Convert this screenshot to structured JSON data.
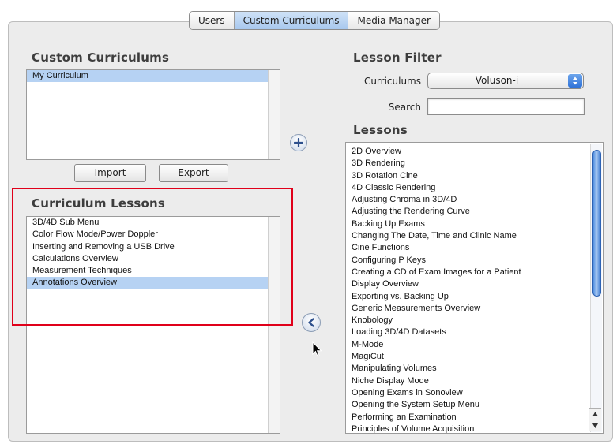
{
  "tabs": [
    {
      "label": "Users",
      "active": false
    },
    {
      "label": "Custom Curriculums",
      "active": true
    },
    {
      "label": "Media Manager",
      "active": false
    }
  ],
  "custom_curriculums": {
    "heading": "Custom Curriculums",
    "items": [
      {
        "label": "My Curriculum",
        "selected": true
      }
    ],
    "import_label": "Import",
    "export_label": "Export"
  },
  "curriculum_lessons": {
    "heading": "Curriculum Lessons",
    "items": [
      {
        "label": "3D/4D Sub Menu",
        "selected": false
      },
      {
        "label": "Color Flow Mode/Power Doppler",
        "selected": false
      },
      {
        "label": "Inserting and Removing a USB Drive",
        "selected": false
      },
      {
        "label": "Calculations Overview",
        "selected": false
      },
      {
        "label": "Measurement Techniques",
        "selected": false
      },
      {
        "label": "Annotations Overview",
        "selected": true
      }
    ]
  },
  "lesson_filter": {
    "heading": "Lesson Filter",
    "curriculums_label": "Curriculums",
    "curriculums_value": "Voluson-i",
    "search_label": "Search",
    "search_value": ""
  },
  "lessons": {
    "heading": "Lessons",
    "items": [
      "2D Overview",
      "3D Rendering",
      "3D Rotation Cine",
      "4D Classic Rendering",
      "Adjusting Chroma in 3D/4D",
      "Adjusting the Rendering Curve",
      "Backing Up Exams",
      "Changing The Date, Time and Clinic Name",
      "Cine Functions",
      "Configuring P Keys",
      "Creating a CD of Exam Images for a Patient",
      "Display Overview",
      "Exporting vs. Backing Up",
      "Generic Measurements Overview",
      "Knobology",
      "Loading 3D/4D Datasets",
      "M-Mode",
      "MagiCut",
      "Manipulating Volumes",
      "Niche Display Mode",
      "Opening Exams in Sonoview",
      "Opening the System Setup Menu",
      "Performing an Examination",
      "Principles of Volume Acquisition"
    ]
  },
  "icons": {
    "add": "plus-icon",
    "move_left": "arrow-left-icon",
    "cursor": "mouse-pointer-icon"
  },
  "colors": {
    "selection": "#b6d2f3",
    "highlight_outline": "#e0001a",
    "accent": "#2f72d8"
  }
}
